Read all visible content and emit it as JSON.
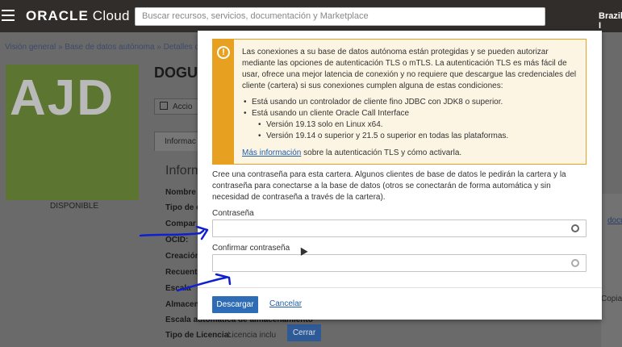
{
  "header": {
    "logo_brand": "ORACLE",
    "logo_product": " Cloud",
    "search_placeholder": "Buscar recursos, servicios, documentación y Marketplace",
    "region": "Brazil I"
  },
  "background": {
    "breadcrumb": "Visión general » Base de datos autónoma » Detalles de S",
    "tile_text": "AJD",
    "status": "DISPONIBLE",
    "db_title": "DOGU",
    "actions_label": "Accio",
    "tab_label": "Informac",
    "section_title": "Inform",
    "fields": [
      {
        "label": "Nombre d",
        "value": ""
      },
      {
        "label": "Tipo de c",
        "value": ""
      },
      {
        "label": "Compar",
        "value": ""
      },
      {
        "label": "OCID:",
        "value": ""
      },
      {
        "label": "Creación",
        "value": ""
      },
      {
        "label": "Recuento",
        "value": ""
      },
      {
        "label": "Escala",
        "value": ""
      },
      {
        "label": "Almacen",
        "value": ""
      },
      {
        "label": "Escala automática de almacenamiento",
        "value": ""
      },
      {
        "label": "Tipo de Licencia:",
        "value": "Licencia inclu"
      }
    ],
    "right_link": "docu",
    "right_copy": "Copiar",
    "close_button": "Cerrar"
  },
  "modal": {
    "alert": {
      "paragraph": "Las conexiones a su base de datos autónoma están protegidas y se pueden autorizar mediante las opciones de autenticación TLS o mTLS. La autenticación TLS es más fácil de usar, ofrece una mejor latencia de conexión y no requiere que descargue las credenciales del cliente (cartera) si sus conexiones cumplen alguna de estas condiciones:",
      "item1": "Está usando un controlador de cliente fino JDBC con JDK8 o superior.",
      "item2": "Está usando un cliente Oracle Call Interface",
      "subitem1": "Versión 19.13 solo en Linux x64.",
      "subitem2": "Versión 19.14 o superior y 21.5 o superior en todas las plataformas.",
      "link": "Más información",
      "link_suffix": " sobre la autenticación TLS y cómo activarla."
    },
    "description": "Cree una contraseña para esta cartera. Algunos clientes de base de datos le pedirán la cartera y la contraseña para conectarse a la base de datos (otros se conectarán de forma automática y sin necesidad de contraseña a través de la cartera).",
    "password_label": "Contraseña",
    "password_value": "",
    "confirm_label": "Confirmar contraseña",
    "confirm_value": "",
    "download_button": "Descargar",
    "cancel_link": "Cancelar"
  },
  "colors": {
    "topbar": "#312d2a",
    "alert_accent": "#e8a020",
    "primary_button": "#2e6db5",
    "link": "#1f5ea8",
    "annotation_pen": "#1020d0"
  }
}
